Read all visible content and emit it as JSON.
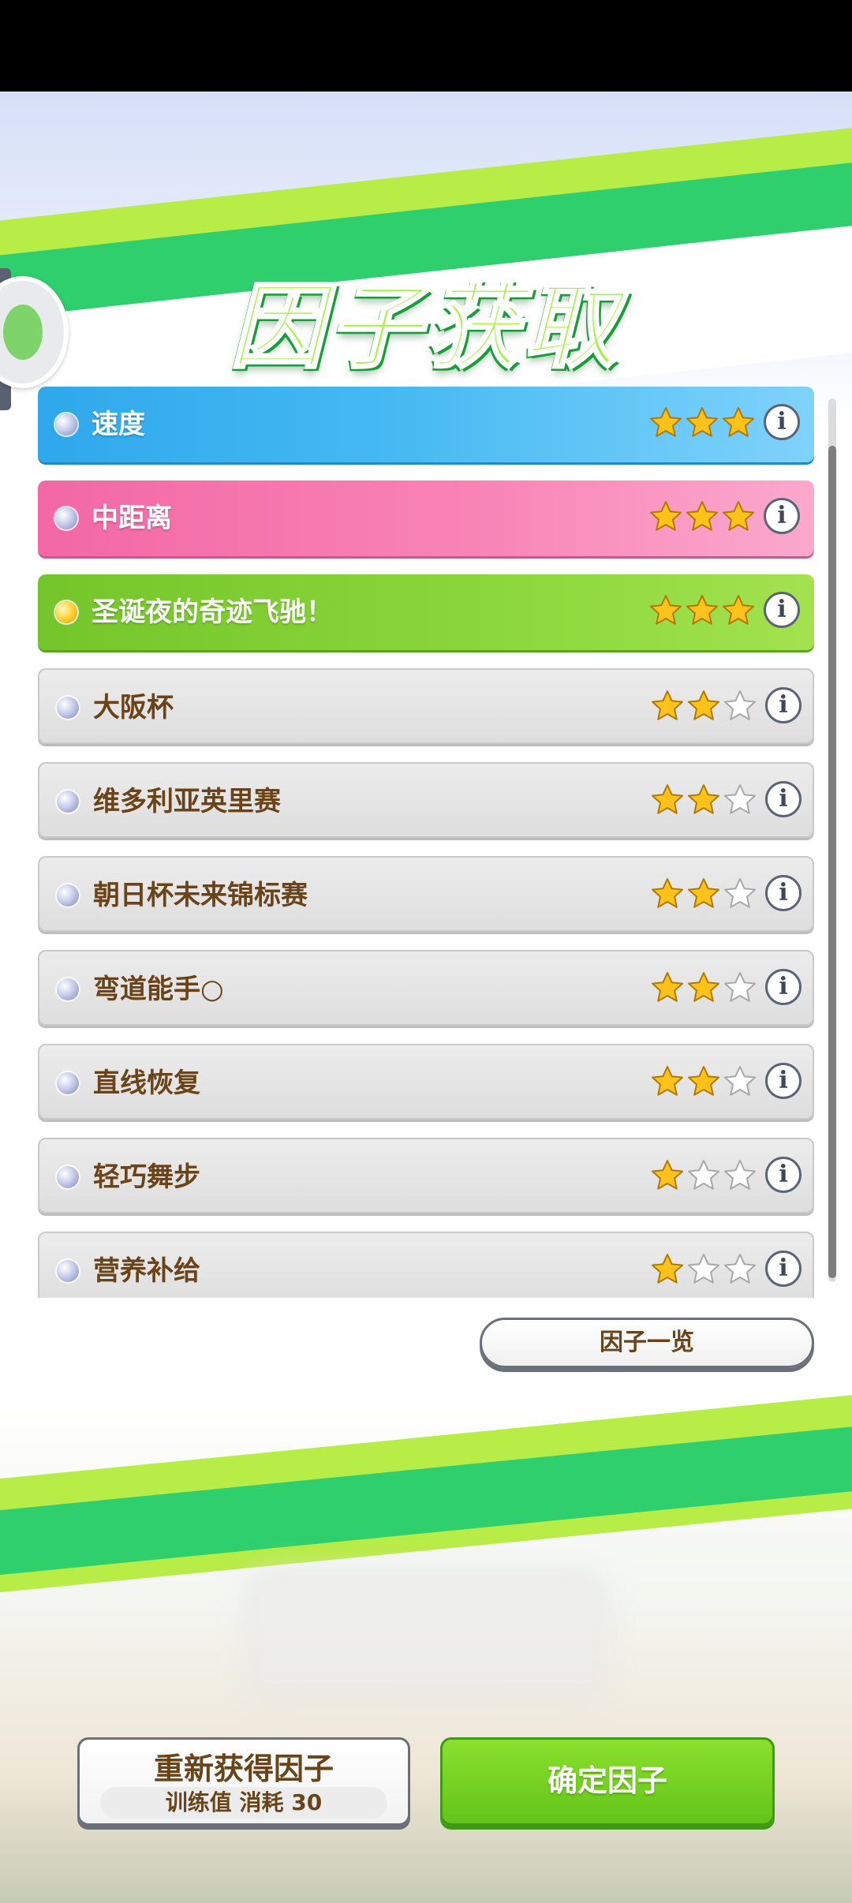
{
  "screen": {
    "title": "因子获取",
    "factor_list_button": "因子一览"
  },
  "factors": [
    {
      "label": "速度",
      "stars": 3,
      "style": "blue"
    },
    {
      "label": "中距离",
      "stars": 3,
      "style": "pink"
    },
    {
      "label": "圣诞夜的奇迹飞驰！",
      "stars": 3,
      "style": "green"
    },
    {
      "label": "大阪杯",
      "stars": 2,
      "style": "gray"
    },
    {
      "label": "维多利亚英里赛",
      "stars": 2,
      "style": "gray"
    },
    {
      "label": "朝日杯未来锦标赛",
      "stars": 2,
      "style": "gray"
    },
    {
      "label": "弯道能手○",
      "stars": 2,
      "style": "gray"
    },
    {
      "label": "直线恢复",
      "stars": 2,
      "style": "gray"
    },
    {
      "label": "轻巧舞步",
      "stars": 1,
      "style": "gray"
    },
    {
      "label": "营养补给",
      "stars": 1,
      "style": "gray"
    }
  ],
  "max_stars": 3,
  "info_icon_glyph": "i",
  "bottom": {
    "redo_button_label": "重新获得因子",
    "redo_cost_label": "训练值 消耗 30",
    "confirm_button_label": "确定因子"
  },
  "colors": {
    "star_filled": "#ffc21a",
    "star_empty": "#ffffff",
    "accent_green": "#63c41a",
    "text_brown": "#6b4318"
  }
}
